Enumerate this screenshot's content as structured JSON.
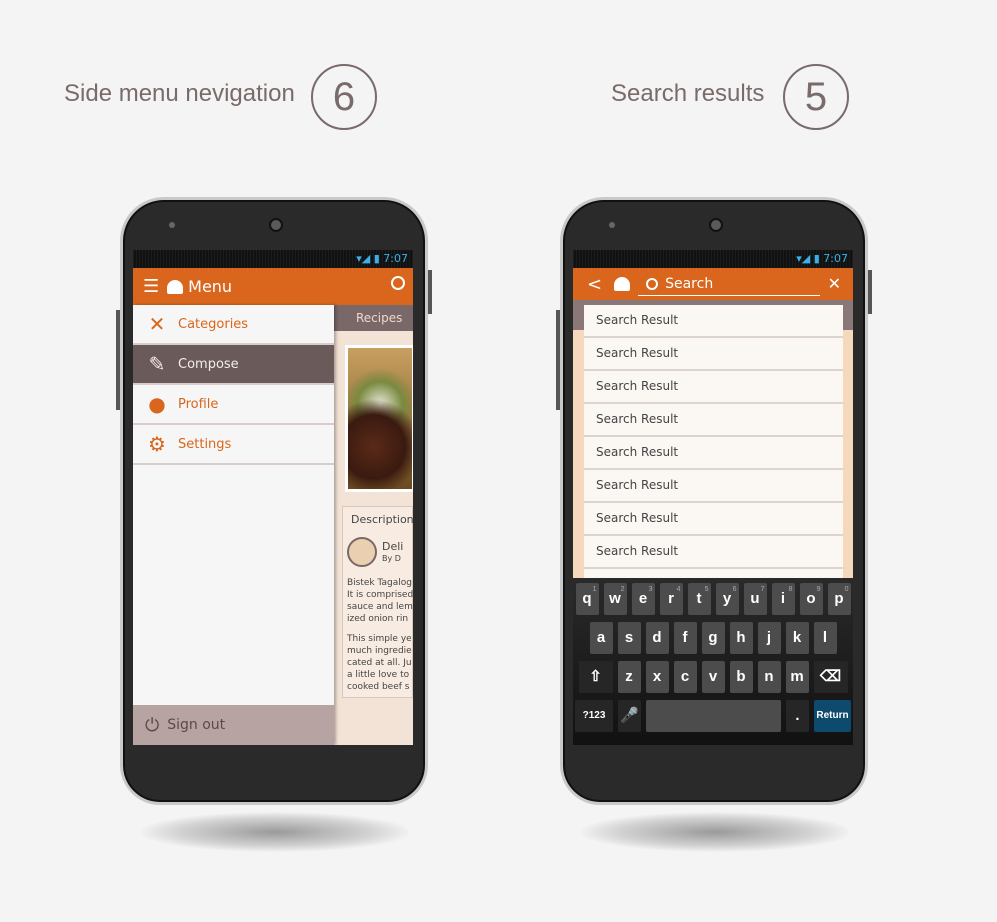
{
  "left": {
    "caption": "Side menu nevigation",
    "step": "6",
    "status_time": "7:07",
    "header": {
      "title": "Menu",
      "menu_icon": "hamburger-icon",
      "logo_icon": "chef-hat-icon",
      "search_icon": "search-icon"
    },
    "drawer": {
      "items": [
        {
          "label": "Categories",
          "icon": "fork-spoon-icon"
        },
        {
          "label": "Compose",
          "icon": "compose-icon",
          "selected": true
        },
        {
          "label": "Profile",
          "icon": "person-icon"
        },
        {
          "label": "Settings",
          "icon": "gear-icon"
        }
      ],
      "sign_out": "Sign out"
    },
    "content": {
      "tab": "Recipes",
      "section": "Description",
      "author_name": "Deli",
      "author_by": "By D",
      "body1": [
        "Bistek Tagalog",
        "It is comprised",
        "sauce and lem",
        "ized onion rin"
      ],
      "body2": [
        "This simple ye",
        "much ingredie",
        "cated at all. Ju",
        "a little love to",
        "cooked beef s"
      ]
    }
  },
  "right": {
    "caption": "Search results",
    "step": "5",
    "status_time": "7:07",
    "search": {
      "placeholder": "Search",
      "back_icon": "back-chevron-icon",
      "clear_icon": "close-icon"
    },
    "results": [
      "Search Result",
      "Search Result",
      "Search Result",
      "Search Result",
      "Search Result",
      "Search Result",
      "Search Result",
      "Search Result"
    ],
    "keyboard": {
      "row1": [
        "q",
        "w",
        "e",
        "r",
        "t",
        "y",
        "u",
        "i",
        "o",
        "p"
      ],
      "hints": [
        "1",
        "2",
        "3",
        "4",
        "5",
        "6",
        "7",
        "8",
        "9",
        "0"
      ],
      "row2": [
        "a",
        "s",
        "d",
        "f",
        "g",
        "h",
        "j",
        "k",
        "l"
      ],
      "row3": [
        "z",
        "x",
        "c",
        "v",
        "b",
        "n",
        "m"
      ],
      "symbols": "?123",
      "period": ".",
      "return": "Return"
    }
  },
  "colors": {
    "accent": "#d9661c",
    "selected": "#6b5a5a",
    "signout": "#b8a3a3"
  }
}
